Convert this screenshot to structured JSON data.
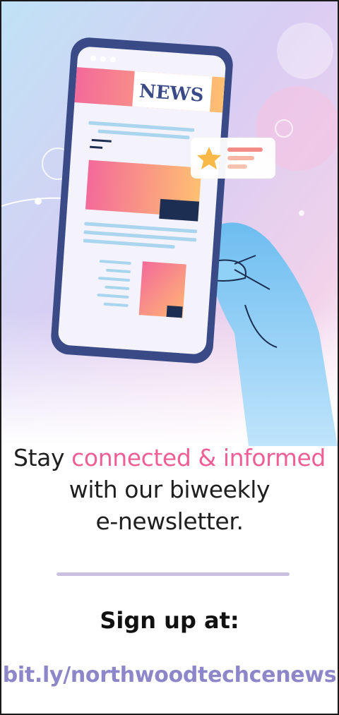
{
  "illustration": {
    "phone_banner_text": "NEWS",
    "icons": [
      "star-icon",
      "hand-icon",
      "phone-icon"
    ]
  },
  "headline": {
    "prefix": "Stay ",
    "accent": "connected & informed",
    "line2": "with our biweekly",
    "line3": "e-newsletter."
  },
  "signup": {
    "label": "Sign up at:",
    "link": "bit.ly/northwoodtechcenews"
  },
  "colors": {
    "accent_pink": "#ef5f96",
    "link_purple": "#8d86c9",
    "divider": "#cbc0e0",
    "phone_frame": "#3a4a86",
    "hand_blue": "#7cc6f2"
  }
}
